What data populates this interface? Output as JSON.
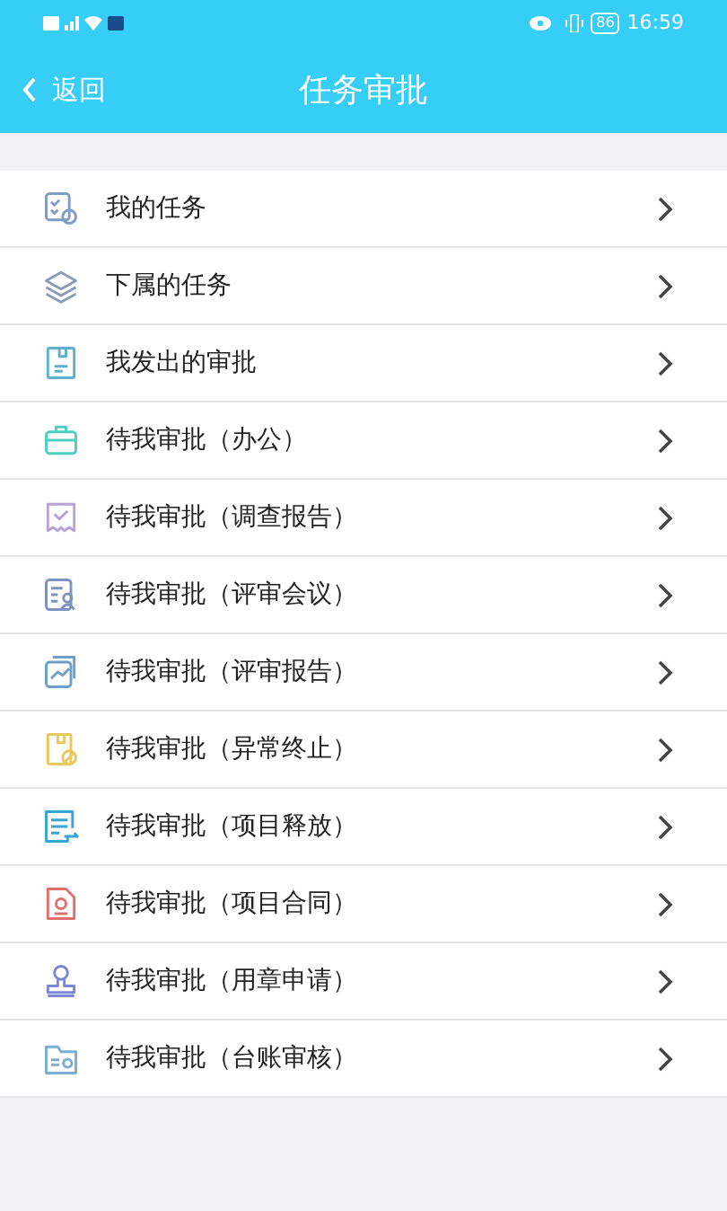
{
  "status_bar": {
    "battery": "86",
    "time": "16:59"
  },
  "header": {
    "back": "返回",
    "title": "任务审批"
  },
  "items": [
    {
      "label": "我的任务",
      "kind": "checklist",
      "color": "#7f9cc4"
    },
    {
      "label": "下属的任务",
      "kind": "layers",
      "color": "#8a9bb8"
    },
    {
      "label": "我发出的审批",
      "kind": "document",
      "color": "#5fb0d0"
    },
    {
      "label": "待我审批（办公）",
      "kind": "briefcase",
      "color": "#4fcfc0"
    },
    {
      "label": "待我审批（调查报告）",
      "kind": "receipt",
      "color": "#b9a3d6"
    },
    {
      "label": "待我审批（评审会议）",
      "kind": "person-form",
      "color": "#7d93bd"
    },
    {
      "label": "待我审批（评审报告）",
      "kind": "chart",
      "color": "#6f9fc8"
    },
    {
      "label": "待我审批（异常终止）",
      "kind": "block",
      "color": "#e8c95a"
    },
    {
      "label": "待我审批（项目释放）",
      "kind": "list-arrow",
      "color": "#3ba5d0"
    },
    {
      "label": "待我审批（项目合同）",
      "kind": "contract",
      "color": "#e07070"
    },
    {
      "label": "待我审批（用章申请）",
      "kind": "stamp",
      "color": "#7b86d6"
    },
    {
      "label": "待我审批（台账审核）",
      "kind": "folder",
      "color": "#7aaed6"
    }
  ]
}
